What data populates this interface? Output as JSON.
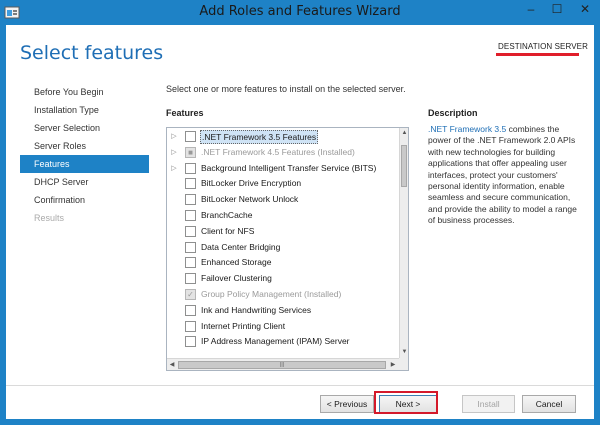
{
  "window": {
    "title": "Add Roles and Features Wizard",
    "icons": {
      "app": "wizard-icon",
      "minimize": "minimize-icon",
      "maximize": "maximize-icon",
      "close": "close-icon"
    },
    "minimize_glyph": "–",
    "maximize_glyph": "☐",
    "close_glyph": "✕"
  },
  "header": {
    "page_title": "Select features",
    "destination_label": "DESTINATION SERVER"
  },
  "nav": {
    "items": [
      {
        "label": "Before You Begin",
        "state": "normal"
      },
      {
        "label": "Installation Type",
        "state": "normal"
      },
      {
        "label": "Server Selection",
        "state": "normal"
      },
      {
        "label": "Server Roles",
        "state": "normal"
      },
      {
        "label": "Features",
        "state": "active"
      },
      {
        "label": "DHCP Server",
        "state": "normal"
      },
      {
        "label": "Confirmation",
        "state": "normal"
      },
      {
        "label": "Results",
        "state": "disabled"
      }
    ]
  },
  "main": {
    "intro": "Select one or more features to install on the selected server.",
    "features_header": "Features",
    "features": [
      {
        "label": ".NET Framework 3.5 Features",
        "expandable": true,
        "checked": false,
        "selected": true,
        "disabled": false
      },
      {
        "label": ".NET Framework 4.5 Features (Installed)",
        "expandable": true,
        "checked": "partial",
        "selected": false,
        "disabled": true
      },
      {
        "label": "Background Intelligent Transfer Service (BITS)",
        "expandable": true,
        "checked": false,
        "selected": false,
        "disabled": false
      },
      {
        "label": "BitLocker Drive Encryption",
        "expandable": false,
        "checked": false,
        "selected": false,
        "disabled": false
      },
      {
        "label": "BitLocker Network Unlock",
        "expandable": false,
        "checked": false,
        "selected": false,
        "disabled": false
      },
      {
        "label": "BranchCache",
        "expandable": false,
        "checked": false,
        "selected": false,
        "disabled": false
      },
      {
        "label": "Client for NFS",
        "expandable": false,
        "checked": false,
        "selected": false,
        "disabled": false
      },
      {
        "label": "Data Center Bridging",
        "expandable": false,
        "checked": false,
        "selected": false,
        "disabled": false
      },
      {
        "label": "Enhanced Storage",
        "expandable": false,
        "checked": false,
        "selected": false,
        "disabled": false
      },
      {
        "label": "Failover Clustering",
        "expandable": false,
        "checked": false,
        "selected": false,
        "disabled": false
      },
      {
        "label": "Group Policy Management (Installed)",
        "expandable": false,
        "checked": true,
        "selected": false,
        "disabled": true
      },
      {
        "label": "Ink and Handwriting Services",
        "expandable": false,
        "checked": false,
        "selected": false,
        "disabled": false
      },
      {
        "label": "Internet Printing Client",
        "expandable": false,
        "checked": false,
        "selected": false,
        "disabled": false
      },
      {
        "label": "IP Address Management (IPAM) Server",
        "expandable": false,
        "checked": false,
        "selected": false,
        "disabled": false
      }
    ],
    "expand_glyph": "▷",
    "check_glyph": "✓",
    "partial_glyph": "■",
    "scroll_up_glyph": "▲",
    "scroll_down_glyph": "▼",
    "scroll_left_glyph": "◀",
    "scroll_right_glyph": "▶",
    "hthumb_glyph": "|||"
  },
  "description": {
    "header": "Description",
    "link_text": ".NET Framework 3.5",
    "body": " combines the power of the .NET Framework 2.0 APIs with new technologies for building applications that offer appealing user interfaces, protect your customers' personal identity information, enable seamless and secure communication, and provide the ability to model a range of business processes."
  },
  "footer": {
    "previous_label": "< Previous",
    "next_label": "Next >",
    "install_label": "Install",
    "cancel_label": "Cancel"
  },
  "colors": {
    "accent": "#1e82c6",
    "title_blue": "#1e6eb5",
    "highlight_red": "#d4192a"
  }
}
